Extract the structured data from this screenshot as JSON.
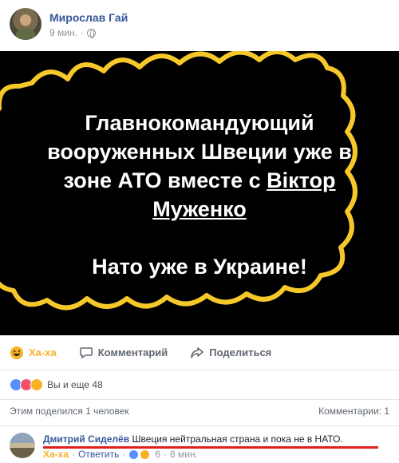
{
  "post": {
    "author": "Мирослав Гай",
    "time": "9 мин.",
    "privacy_icon": "globe-icon",
    "image_text": {
      "line1": "Главнокомандующий вооруженных Швеции уже в зоне АТО вместе с",
      "tag": "Віктор Муженко",
      "line2": "Нато уже в Украине!"
    }
  },
  "actions": {
    "haha": "Ха-ха",
    "comment": "Комментарий",
    "share": "Поделиться"
  },
  "reactions": {
    "summary": "Вы и еще 48",
    "types": [
      "like",
      "love",
      "haha"
    ]
  },
  "stats": {
    "shares": "Этим поделился 1 человек",
    "comments": "Комментарии: 1"
  },
  "comment": {
    "author": "Дмитрий Сиделёв",
    "text": "Швеция нейтральная страна и пока не в НАТО.",
    "haha": "Ха-ха",
    "dot1": "·",
    "reply": "Ответить",
    "dot2": "·",
    "reaction_count": "6",
    "dot3": "·",
    "time": "8 мин."
  },
  "colors": {
    "link": "#365899",
    "haha": "#f7b125",
    "underline": "#e0201b",
    "cloud": "#f7c829"
  }
}
